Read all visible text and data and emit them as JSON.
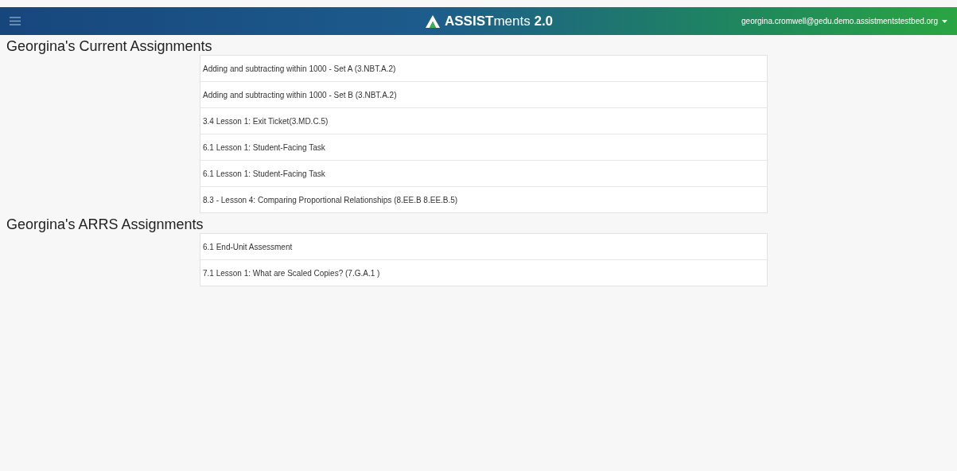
{
  "header": {
    "logo": "**ASSIST**ments **2.0**",
    "user": "georgina.cromwell@gedu.demo.assistmentstestbed.org"
  },
  "sections": [
    {
      "title": "Georgina's Current Assignments",
      "items": [
        "Adding and subtracting within 1000 - Set A (3.NBT.A.2)",
        "Adding and subtracting within 1000 - Set B (3.NBT.A.2)",
        "3.4 Lesson 1: Exit Ticket(3.MD.C.5)",
        "6.1 Lesson 1: Student-Facing Task",
        "6.1 Lesson 1: Student-Facing Task",
        "8.3 - Lesson 4: Comparing Proportional Relationships (8.EE.B 8.EE.B.5)"
      ]
    },
    {
      "title": "Georgina's ARRS Assignments",
      "items": [
        "6.1 End-Unit Assessment",
        "7.1 Lesson 1: What are Scaled Copies? (7.G.A.1 )"
      ]
    }
  ]
}
